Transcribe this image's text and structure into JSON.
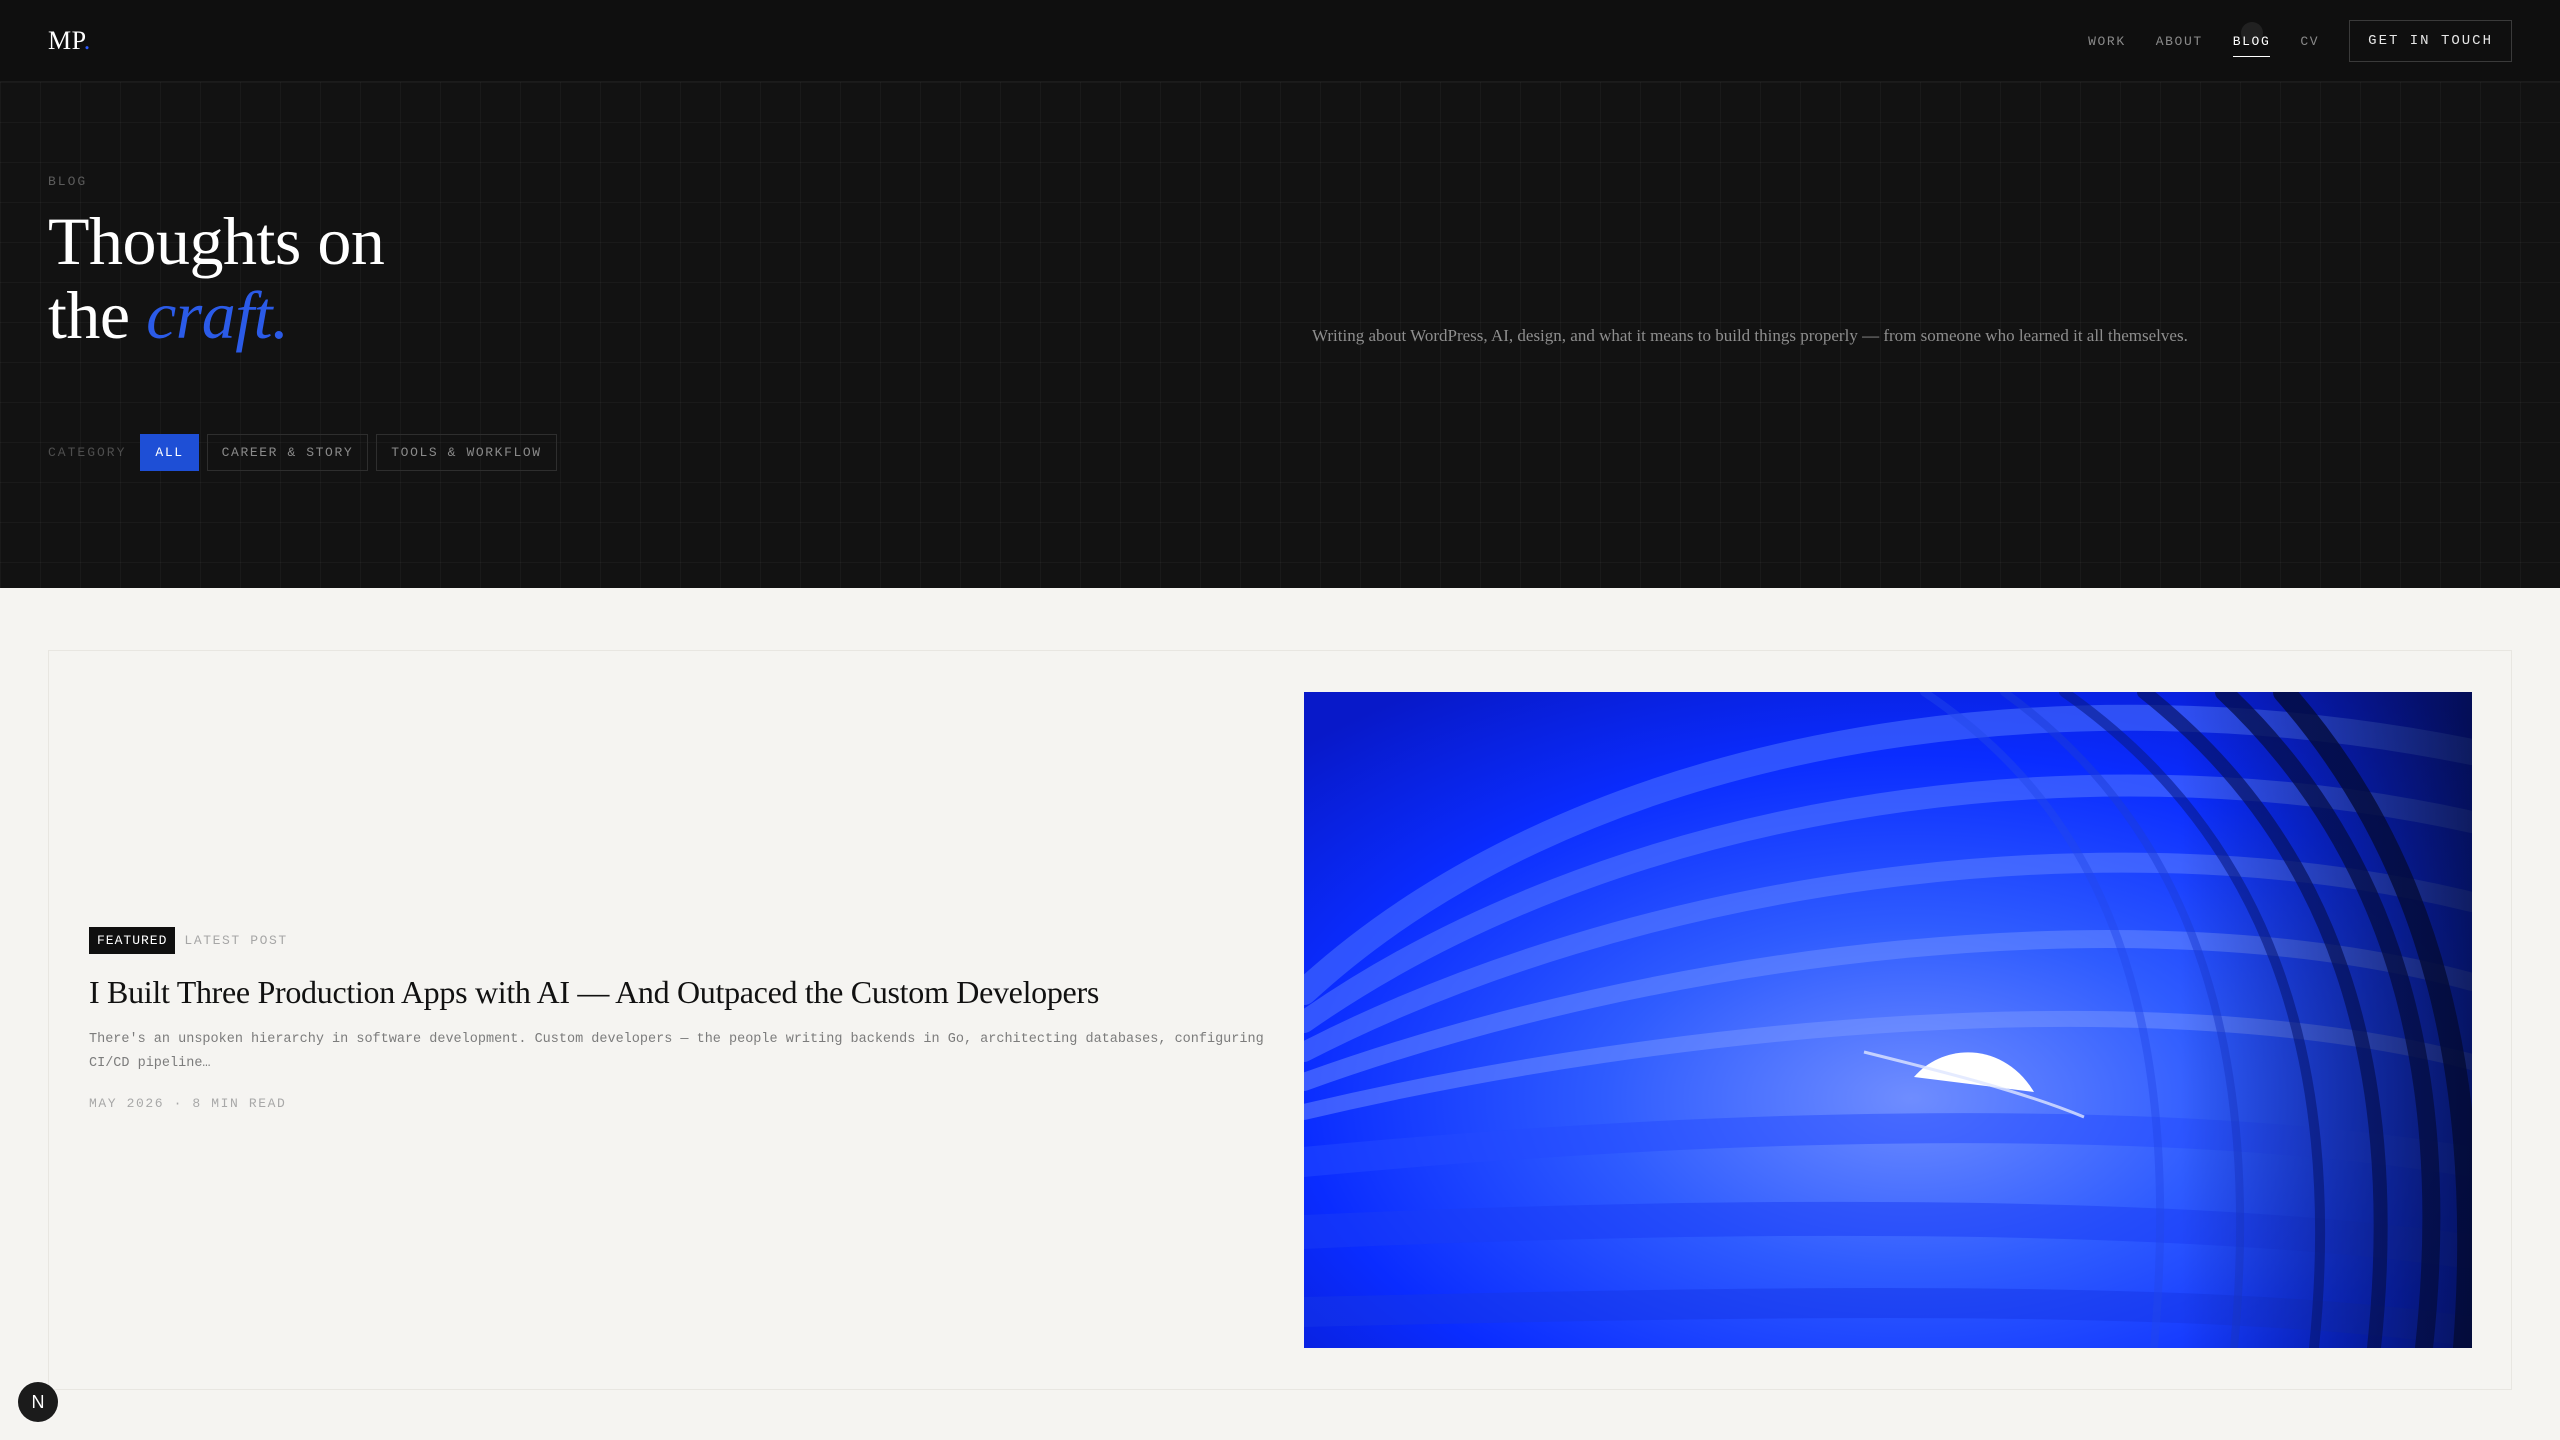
{
  "header": {
    "logo": "MP",
    "logo_dot": ".",
    "nav": [
      "WORK",
      "ABOUT",
      "BLOG",
      "CV"
    ],
    "active_nav": "BLOG",
    "cta_label": "GET IN TOUCH"
  },
  "hero": {
    "eyebrow": "BLOG",
    "title_line1": "Thoughts on",
    "title_line2_prefix": "the ",
    "title_accent": "craft.",
    "description": "Writing about WordPress, AI, design, and what it means to build things properly — from someone who learned it all themselves.",
    "accent_color": "#2b5be8"
  },
  "filters": {
    "label": "CATEGORY",
    "options": [
      "ALL",
      "CAREER & STORY",
      "TOOLS & WORKFLOW"
    ],
    "selected": "ALL"
  },
  "featured_post": {
    "badge": "FEATURED",
    "tag": "LATEST POST",
    "title": "I Built Three Production Apps with AI — And Outpaced the Custom Developers",
    "excerpt": "There's an unspoken hierarchy in software development. Custom developers — the people writing backends in Go, architecting databases, configuring CI/CD pipeline…",
    "meta": "MAY 2026 · 8 MIN READ",
    "image_icon": "abstract-blue-tunnel-image"
  },
  "floating_badge": {
    "label": "N",
    "icon": "nextjs-devtools-icon"
  },
  "colors": {
    "header_bg": "#0f0f0f",
    "hero_bg": "#121212",
    "page_bg": "#f5f4f1",
    "chip_active": "#1e4fd6",
    "image_blue": "#0b2bff"
  }
}
